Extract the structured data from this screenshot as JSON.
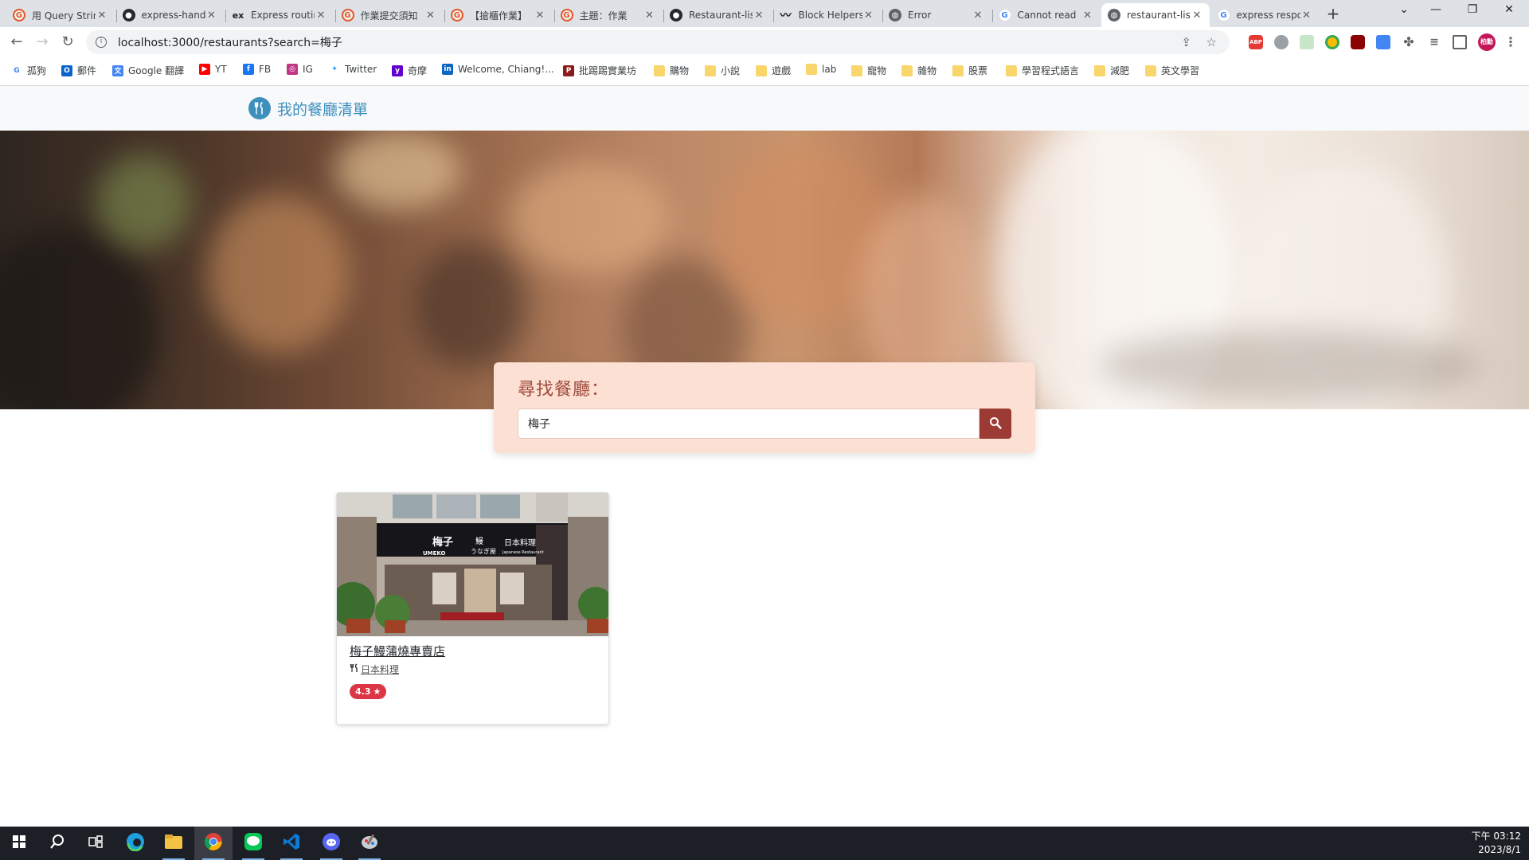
{
  "browser": {
    "tabs": [
      {
        "title": "用 Query String",
        "icon": "zen-icon"
      },
      {
        "title": "express-handlebars",
        "icon": "github-icon"
      },
      {
        "title": "Express routing",
        "icon": "express-icon"
      },
      {
        "title": "作業提交須知",
        "icon": "zen-icon"
      },
      {
        "title": "【搶櫃作業】",
        "icon": "zen-icon"
      },
      {
        "title": "主題：作業",
        "icon": "zen-icon"
      },
      {
        "title": "Restaurant-list",
        "icon": "github-icon"
      },
      {
        "title": "Block Helpers",
        "icon": "handlebars-icon"
      },
      {
        "title": "Error",
        "icon": "globe-icon"
      },
      {
        "title": "Cannot read",
        "icon": "google-icon"
      },
      {
        "title": "restaurant-list",
        "icon": "globe-icon"
      },
      {
        "title": "express response",
        "icon": "google-icon"
      }
    ],
    "active_tab": 10,
    "url": "localhost:3000/restaurants?search=梅子"
  },
  "bookmarks": [
    {
      "label": "孤狗",
      "icon": "google-icon"
    },
    {
      "label": "郵件",
      "icon": "outlook-icon"
    },
    {
      "label": "Google 翻譯",
      "icon": "translate-icon"
    },
    {
      "label": "YT",
      "icon": "youtube-icon"
    },
    {
      "label": "FB",
      "icon": "facebook-icon"
    },
    {
      "label": "IG",
      "icon": "instagram-icon"
    },
    {
      "label": "Twitter",
      "icon": "twitter-icon"
    },
    {
      "label": "奇摩",
      "icon": "yahoo-icon"
    },
    {
      "label": "Welcome, Chiang!...",
      "icon": "linkedin-icon"
    },
    {
      "label": "批踢踢實業坊",
      "icon": "ptt-icon"
    },
    {
      "label": "購物",
      "icon": "folder-icon"
    },
    {
      "label": "小說",
      "icon": "folder-icon"
    },
    {
      "label": "遊戲",
      "icon": "folder-icon"
    },
    {
      "label": "lab",
      "icon": "folder-icon"
    },
    {
      "label": "寵物",
      "icon": "folder-icon"
    },
    {
      "label": "雜物",
      "icon": "folder-icon"
    },
    {
      "label": "股票",
      "icon": "folder-icon"
    },
    {
      "label": "學習程式語言",
      "icon": "folder-icon"
    },
    {
      "label": "減肥",
      "icon": "folder-icon"
    },
    {
      "label": "英文學習",
      "icon": "folder-icon"
    }
  ],
  "extensions": {
    "abp": "ABP",
    "avatar": "柏勳"
  },
  "app": {
    "brand": "我的餐廳清單",
    "search_title": "尋找餐廳：",
    "search_value": "梅子",
    "accent": "#9c3b34"
  },
  "restaurants": [
    {
      "name": "梅子鰻蒲燒專賣店",
      "category": "日本料理",
      "rating": "4.3",
      "sign_main": "梅子",
      "sign_sub": "UMEKO",
      "sign_eel": "鰻",
      "sign_kana": "うなぎ屋",
      "sign_right": "日本料理",
      "sign_en": "Japanese Restaurant"
    }
  ],
  "taskbar": {
    "time": "下午 03:12",
    "date": "2023/8/1"
  }
}
